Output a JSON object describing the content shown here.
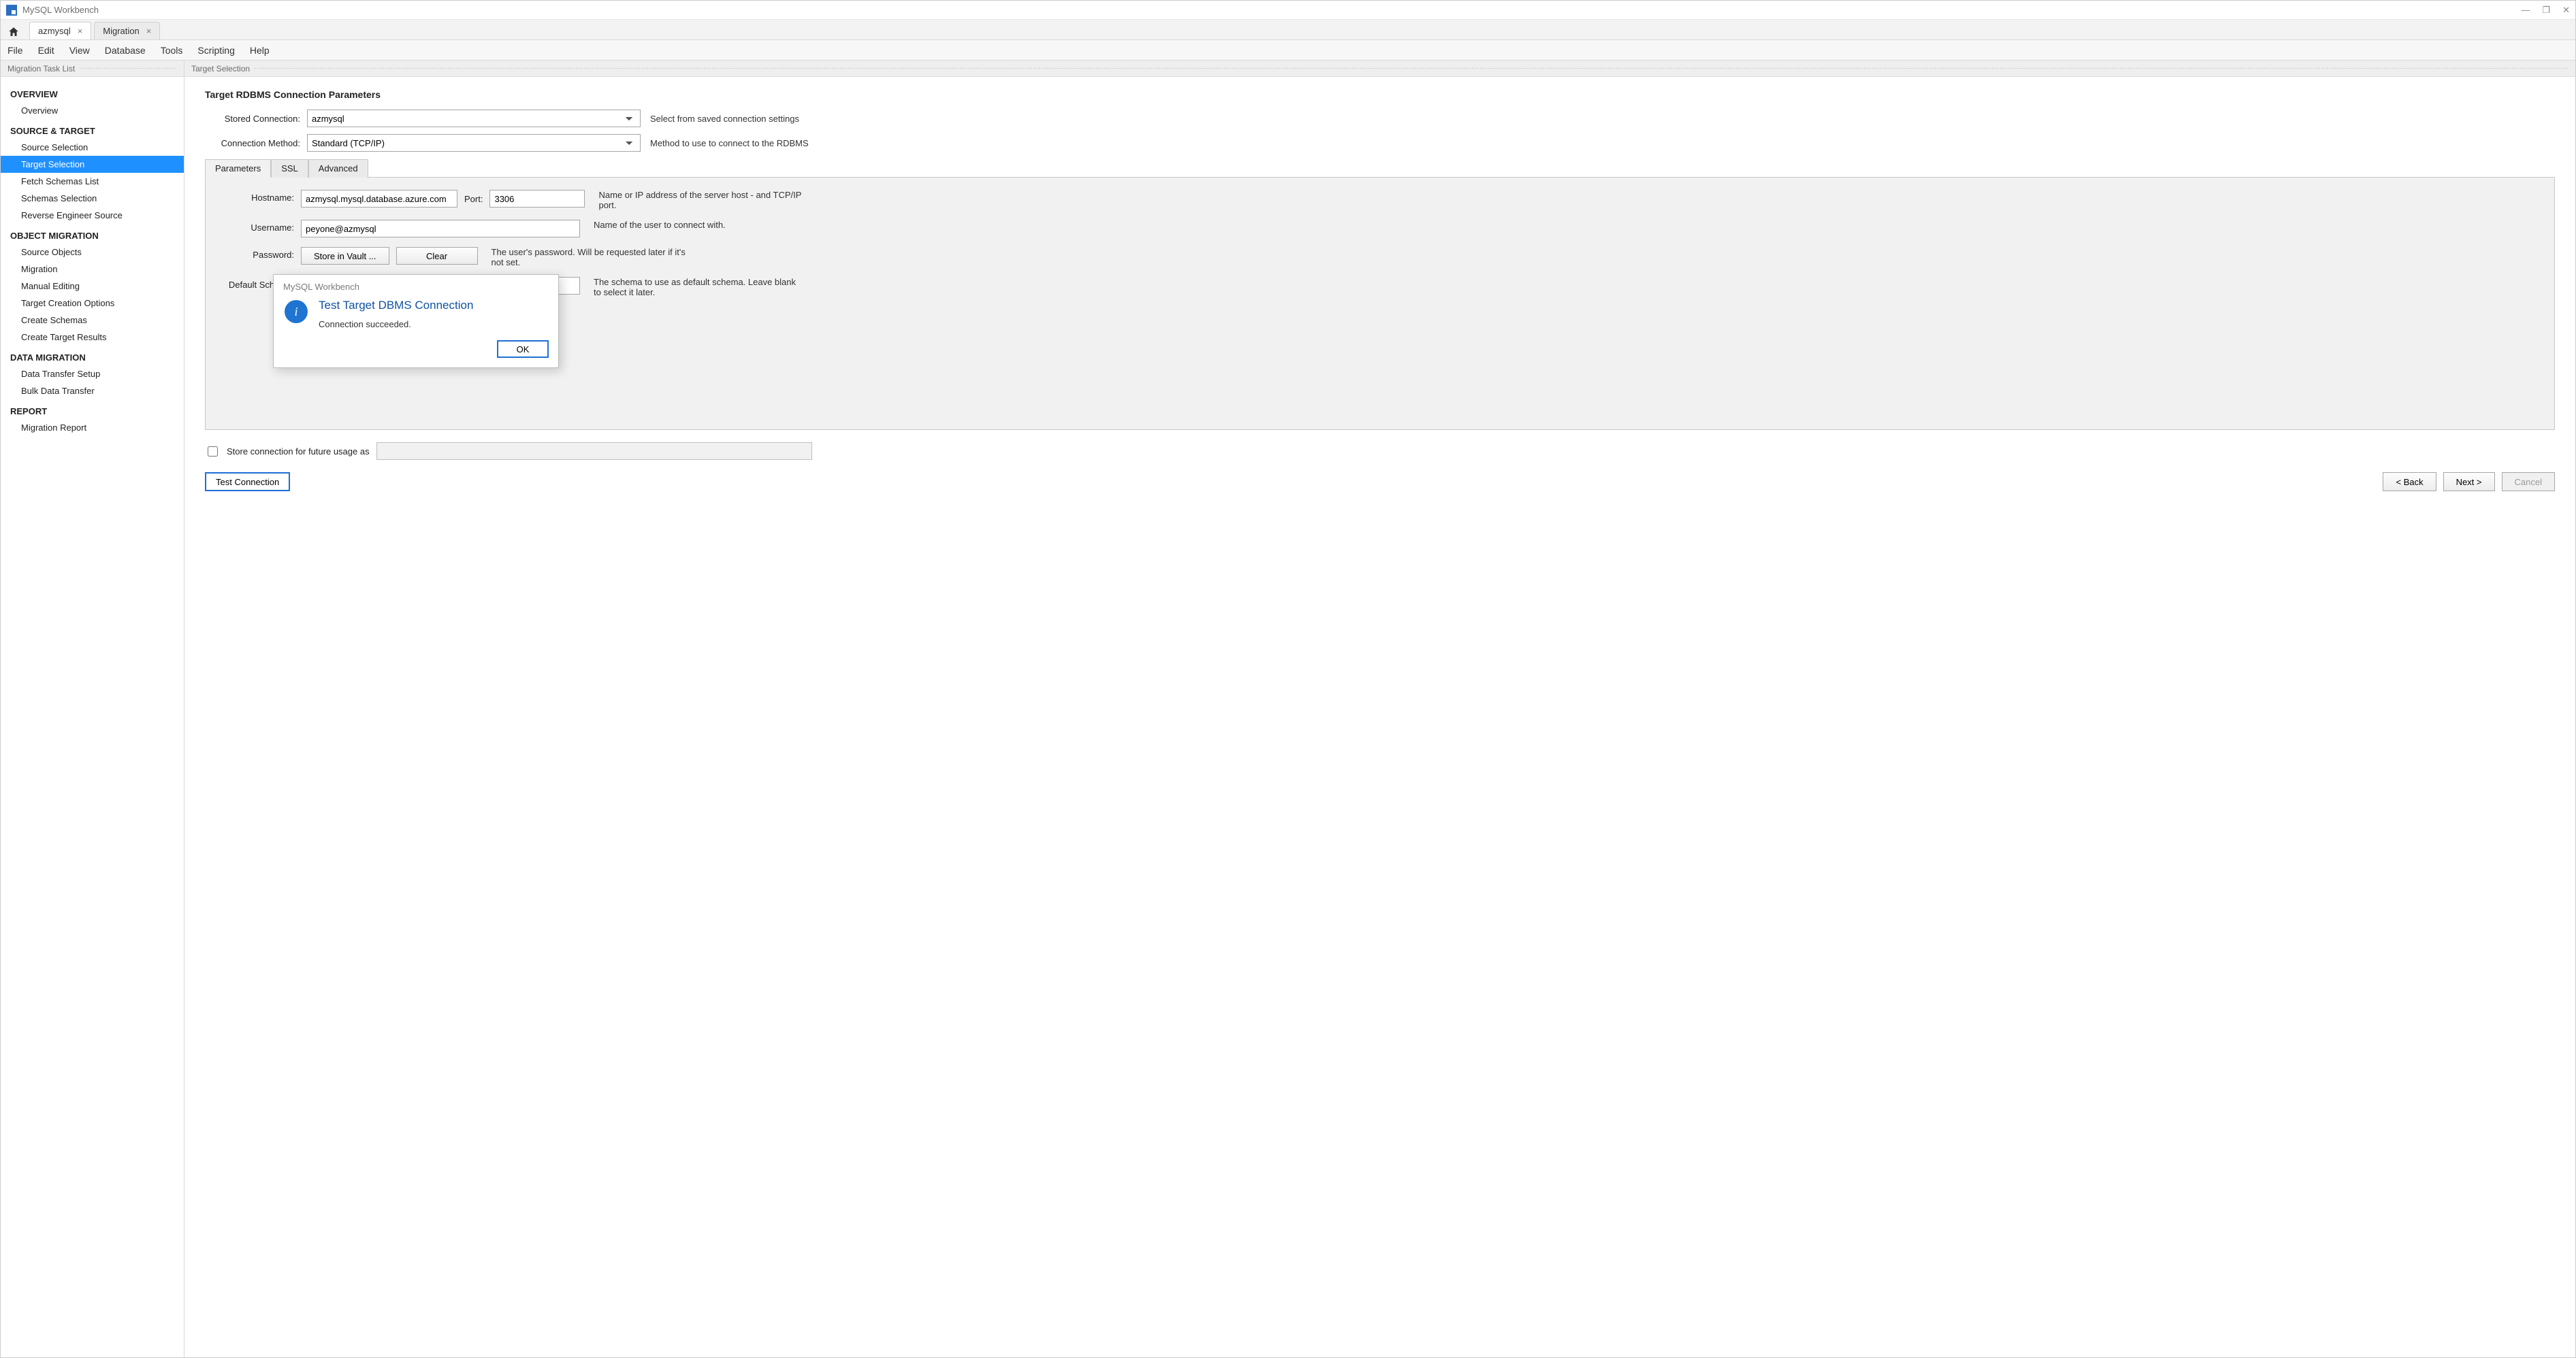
{
  "app": {
    "title": "MySQL Workbench"
  },
  "window_controls": {
    "min": "—",
    "max": "❐",
    "close": "✕"
  },
  "tabs": {
    "home_tooltip": "Home",
    "items": [
      {
        "label": "azmysql",
        "active": true
      },
      {
        "label": "Migration",
        "active": false
      }
    ]
  },
  "menu": [
    "File",
    "Edit",
    "View",
    "Database",
    "Tools",
    "Scripting",
    "Help"
  ],
  "sidebar": {
    "title": "Migration Task List",
    "groups": [
      {
        "heading": "OVERVIEW",
        "items": [
          "Overview"
        ]
      },
      {
        "heading": "SOURCE & TARGET",
        "items": [
          "Source Selection",
          "Target Selection",
          "Fetch Schemas List",
          "Schemas Selection",
          "Reverse Engineer Source"
        ],
        "selected_index": 1
      },
      {
        "heading": "OBJECT MIGRATION",
        "items": [
          "Source Objects",
          "Migration",
          "Manual Editing",
          "Target Creation Options",
          "Create Schemas",
          "Create Target Results"
        ]
      },
      {
        "heading": "DATA MIGRATION",
        "items": [
          "Data Transfer Setup",
          "Bulk Data Transfer"
        ]
      },
      {
        "heading": "REPORT",
        "items": [
          "Migration Report"
        ]
      }
    ]
  },
  "content": {
    "header": "Target Selection",
    "section_title": "Target RDBMS Connection Parameters",
    "stored_connection": {
      "label": "Stored Connection:",
      "value": "azmysql",
      "hint": "Select from saved connection settings"
    },
    "connection_method": {
      "label": "Connection Method:",
      "value": "Standard (TCP/IP)",
      "hint": "Method to use to connect to the RDBMS"
    },
    "inner_tabs": [
      "Parameters",
      "SSL",
      "Advanced"
    ],
    "params": {
      "hostname": {
        "label": "Hostname:",
        "value": "azmysql.mysql.database.azure.com",
        "port_label": "Port:",
        "port_value": "3306",
        "hint": "Name or IP address of the server host - and TCP/IP port."
      },
      "username": {
        "label": "Username:",
        "value": "peyone@azmysql",
        "hint": "Name of the user to connect with."
      },
      "password": {
        "label": "Password:",
        "store_btn": "Store in Vault ...",
        "clear_btn": "Clear",
        "hint": "The user's password. Will be requested later if it's not set."
      },
      "default_schema": {
        "label": "Default Schema:",
        "value": "",
        "hint": "The schema to use as default schema. Leave blank to select it later."
      }
    },
    "store_future": {
      "label": "Store connection for future usage as",
      "value": ""
    },
    "buttons": {
      "test": "Test Connection",
      "back": "< Back",
      "next": "Next >",
      "cancel": "Cancel"
    }
  },
  "dialog": {
    "app_label": "MySQL Workbench",
    "heading": "Test Target DBMS Connection",
    "message": "Connection succeeded.",
    "ok": "OK"
  }
}
